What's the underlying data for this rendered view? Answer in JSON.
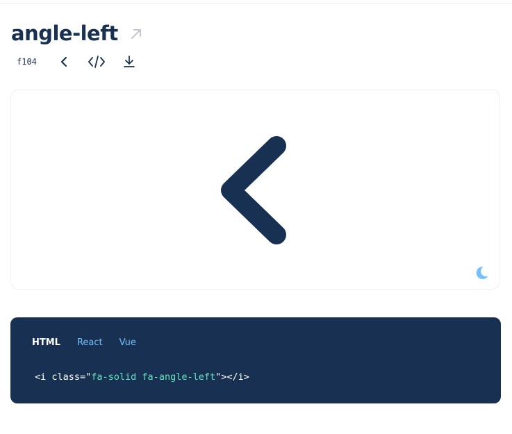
{
  "header": {
    "title": "angle-left",
    "external_icon": "arrow-up-right-icon"
  },
  "toolbar": {
    "unicode": "f104",
    "icons": [
      "angle-left-icon",
      "code-icon",
      "download-icon"
    ]
  },
  "preview": {
    "icon": "angle-left-icon",
    "icon_color": "#183153",
    "theme_toggle_icon": "moon-icon",
    "theme_toggle_color": "#74c0fc"
  },
  "code_panel": {
    "background": "#183153",
    "tabs": [
      {
        "label": "HTML",
        "active": true
      },
      {
        "label": "React",
        "active": false
      },
      {
        "label": "Vue",
        "active": false
      }
    ],
    "snippet": {
      "open": "<i class=\"",
      "value": "fa-solid fa-angle-left",
      "close": "\"></i>"
    }
  }
}
